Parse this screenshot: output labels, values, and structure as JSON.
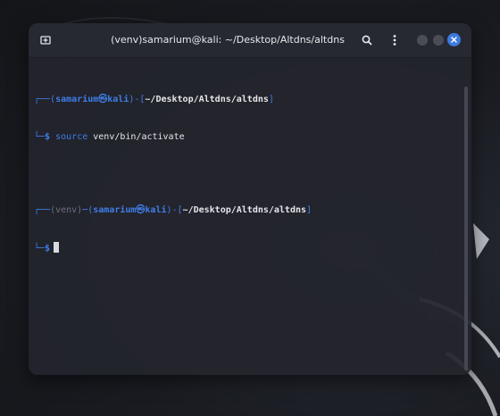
{
  "window": {
    "title": "(venv)samarium@kali: ~/Desktop/Altdns/altdns"
  },
  "icons": {
    "new_tab": "new-tab-icon",
    "search": "search-icon",
    "menu": "kebab-menu-icon",
    "minimize": "minimize-dot",
    "maximize": "maximize-dot",
    "close": "close-x-icon"
  },
  "colors": {
    "accent_blue": "#3f7ee8",
    "close_button": "#3d7ae0",
    "terminal_bg": "#23252d",
    "titlebar_bg": "#262931",
    "text": "#d8dbe0",
    "venv_gray": "#6b7080"
  },
  "terminal": {
    "prompt1": {
      "frame_open": "┌──(",
      "user": "samarium㉿kali",
      "frame_mid": ")-[",
      "path": "~/Desktop/Altdns/altdns",
      "frame_close": "]",
      "frame_bottom": "└─",
      "dollar": "$",
      "command_name": "source",
      "command_args": "venv/bin/activate"
    },
    "prompt2": {
      "frame_open": "┌──",
      "venv": "(venv)",
      "frame_sep": "─(",
      "user": "samarium㉿kali",
      "frame_mid": ")-[",
      "path": "~/Desktop/Altdns/altdns",
      "frame_close": "]",
      "frame_bottom": "└─",
      "dollar": "$"
    }
  }
}
